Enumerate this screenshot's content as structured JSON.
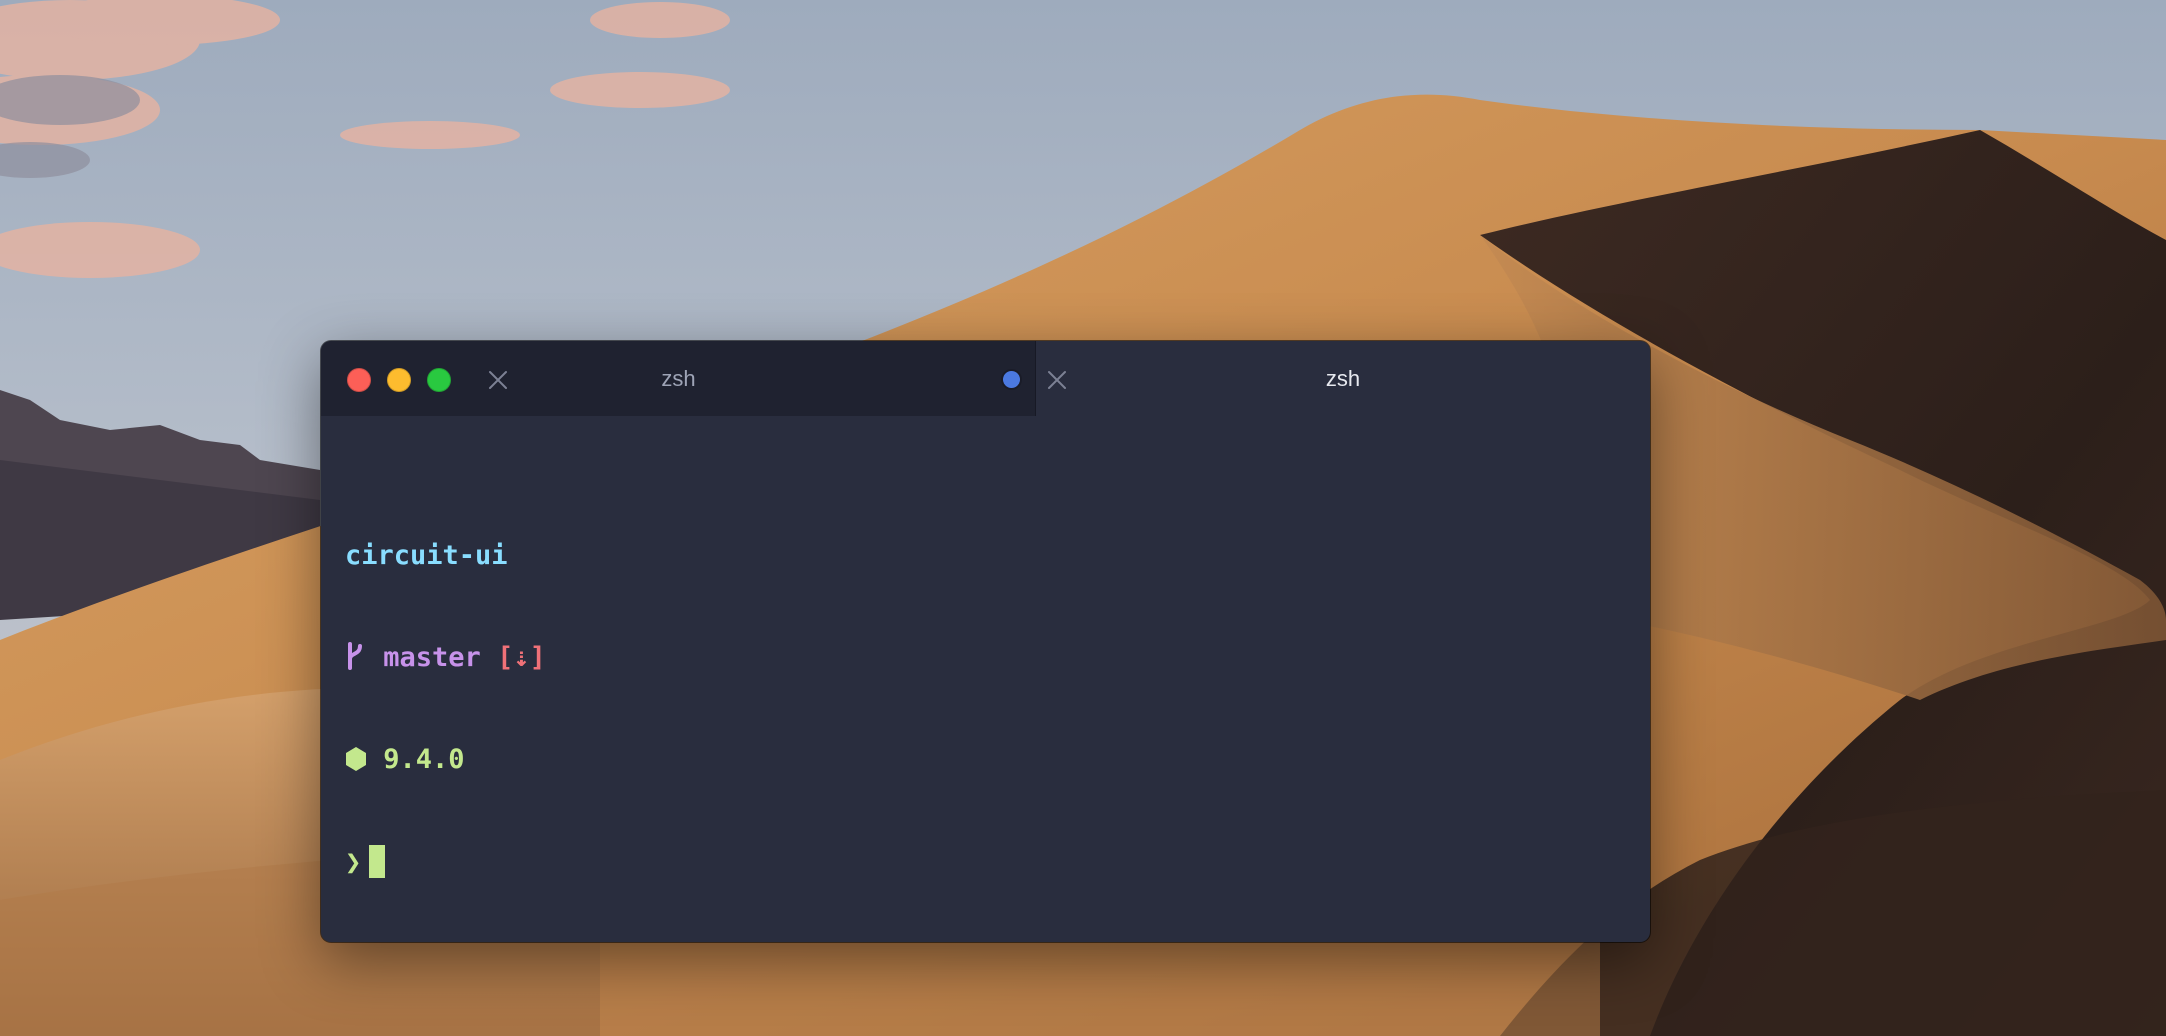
{
  "desktop": {
    "wallpaper": "mojave-dunes"
  },
  "window": {
    "traffic_lights": {
      "close_color": "#fc5f57",
      "minimize_color": "#fdbc2e",
      "maximize_color": "#29c940"
    },
    "tabs": [
      {
        "title": "zsh",
        "active": false,
        "has_activity_dot": true,
        "dot_color": "#4b79e0",
        "close_icon": "close-icon"
      },
      {
        "title": "zsh",
        "active": true,
        "has_activity_dot": false,
        "close_icon": "close-icon"
      }
    ]
  },
  "terminal": {
    "directory": "circuit-ui",
    "branch_icon": "git-branch-icon",
    "branch": "master",
    "git_status": "[⇣]",
    "node_icon": "node-hexagon-icon",
    "node_version": "9.4.0",
    "prompt_symbol": "❯",
    "colors": {
      "background": "#292d3e",
      "directory": "#89ddff",
      "branch": "#c792ea",
      "git_status": "#f07178",
      "node": "#c3e88d",
      "prompt": "#c3e88d",
      "cursor": "#c3e88d"
    }
  }
}
